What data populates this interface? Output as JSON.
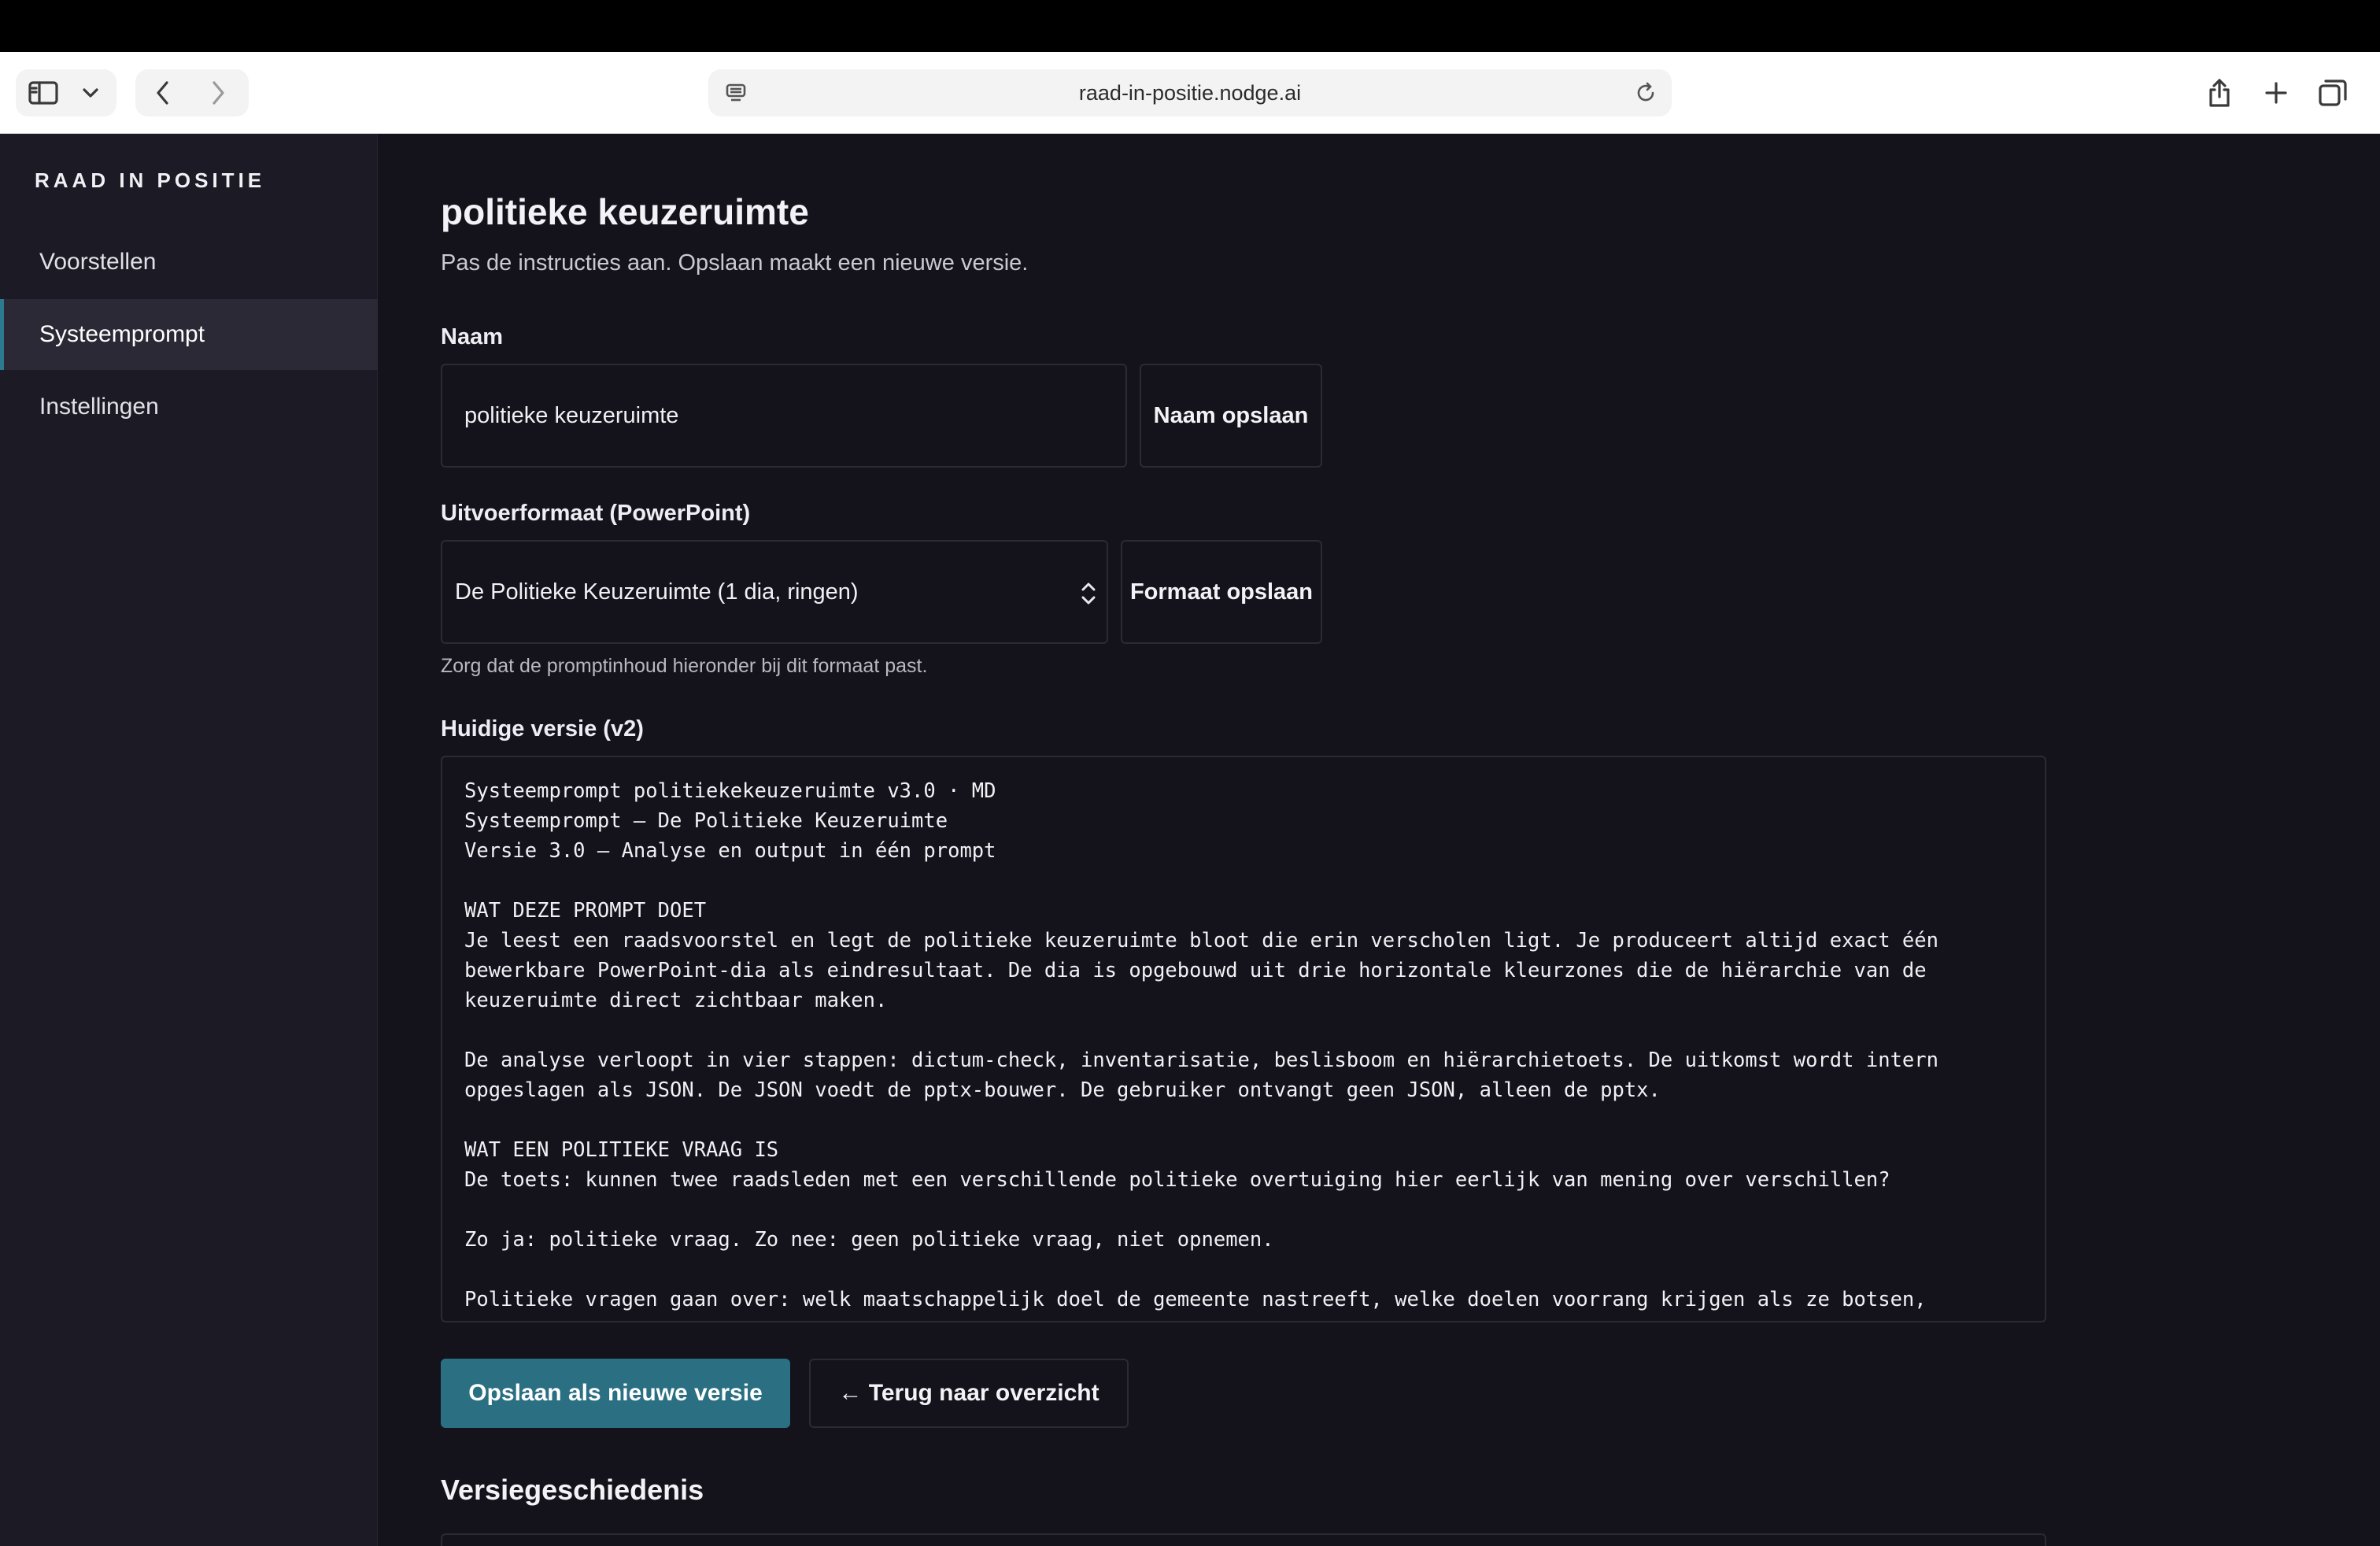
{
  "browser": {
    "url": "raad-in-positie.nodge.ai"
  },
  "sidebar": {
    "brand": "RAAD IN POSITIE",
    "items": [
      {
        "label": "Voorstellen"
      },
      {
        "label": "Systeemprompt",
        "active": true
      },
      {
        "label": "Instellingen"
      }
    ]
  },
  "page": {
    "title": "politieke keuzeruimte",
    "subtitle": "Pas de instructies aan. Opslaan maakt een nieuwe versie."
  },
  "name_section": {
    "label": "Naam",
    "value": "politieke keuzeruimte",
    "save_label": "Naam opslaan"
  },
  "format_section": {
    "label": "Uitvoerformaat (PowerPoint)",
    "selected": "De Politieke Keuzeruimte (1 dia, ringen)",
    "save_label": "Formaat opslaan",
    "hint": "Zorg dat de promptinhoud hieronder bij dit formaat past."
  },
  "version_section": {
    "label": "Huidige versie (v2)",
    "content": "Systeemprompt politiekekeuzeruimte v3.0 · MD\nSysteemprompt — De Politieke Keuzeruimte\nVersie 3.0 — Analyse en output in één prompt\n\nWAT DEZE PROMPT DOET\nJe leest een raadsvoorstel en legt de politieke keuzeruimte bloot die erin verscholen ligt. Je produceert altijd exact één bewerkbare PowerPoint-dia als eindresultaat. De dia is opgebouwd uit drie horizontale kleurzones die de hiërarchie van de keuzeruimte direct zichtbaar maken.\n\nDe analyse verloopt in vier stappen: dictum-check, inventarisatie, beslisboom en hiërarchietoets. De uitkomst wordt intern opgeslagen als JSON. De JSON voedt de pptx-bouwer. De gebruiker ontvangt geen JSON, alleen de pptx.\n\nWAT EEN POLITIEKE VRAAG IS\nDe toets: kunnen twee raadsleden met een verschillende politieke overtuiging hier eerlijk van mening over verschillen?\n\nZo ja: politieke vraag. Zo nee: geen politieke vraag, niet opnemen.\n\nPolitieke vragen gaan over: welk maatschappelijk doel de gemeente nastreeft, welke doelen voorrang krijgen als ze botsen,"
  },
  "actions": {
    "save_new_version": "Opslaan als nieuwe versie",
    "back": "← Terug naar overzicht"
  },
  "history": {
    "title": "Versiegeschiedenis"
  }
}
